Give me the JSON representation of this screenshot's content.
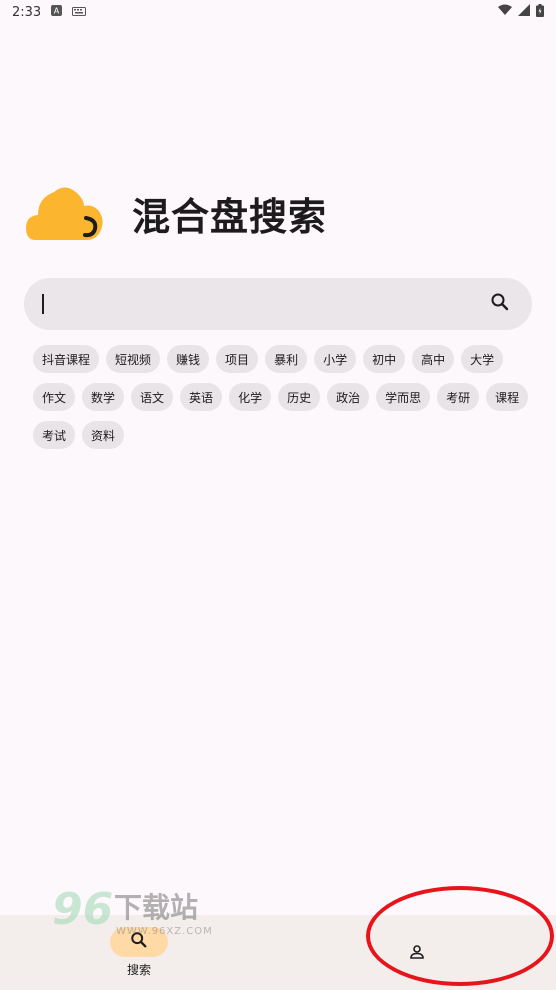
{
  "status_bar": {
    "time": "2:33",
    "icons": [
      "notification-a-icon",
      "keyboard-icon",
      "wifi-icon",
      "signal-icon",
      "battery-icon"
    ]
  },
  "header": {
    "app_title": "混合盘搜索",
    "logo": "cloud-logo"
  },
  "search": {
    "value": "",
    "placeholder": "",
    "icon": "search-icon"
  },
  "tags": [
    "抖音课程",
    "短视频",
    "赚钱",
    "项目",
    "暴利",
    "小学",
    "初中",
    "高中",
    "大学",
    "作文",
    "数学",
    "语文",
    "英语",
    "化学",
    "历史",
    "政治",
    "学而思",
    "考研",
    "课程",
    "考试",
    "资料"
  ],
  "watermark": {
    "number": "96",
    "text": "下载站",
    "url": "WWW.96XZ.COM"
  },
  "bottom_nav": {
    "items": [
      {
        "label": "搜索",
        "icon": "search-icon",
        "active": true
      },
      {
        "label": "",
        "icon": "person-icon",
        "active": false
      }
    ]
  },
  "colors": {
    "background": "#fdf8fb",
    "logo": "#fbb52f",
    "active_nav": "#ffd9a6",
    "annotation": "#e8141b"
  }
}
